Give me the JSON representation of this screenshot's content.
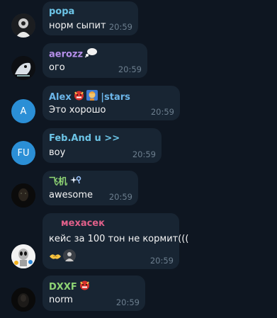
{
  "messages": [
    {
      "name": "popa",
      "name_color": "#6cc4e6",
      "text": "норм сыпит",
      "time": "20:59",
      "avatar": "dark-photo-avatar"
    },
    {
      "name": "aerozz",
      "name_color": "#b48ee8",
      "name_emoji": "thought-balloon-icon",
      "text": "ого",
      "time": "20:59",
      "avatar": "cat-photo-avatar"
    },
    {
      "name": "Alex",
      "name_color": "#6cb6ea",
      "name_suffix": "|stars",
      "name_emojis": [
        "ogre-mask-icon",
        "teacher-icon"
      ],
      "text": "Это хорошо",
      "time": "20:59",
      "avatar": "A",
      "avatar_color": "#2b8fd6"
    },
    {
      "name": "Feb.And u >>",
      "name_color": "#6cc4e6",
      "text": "воу",
      "time": "20:59",
      "avatar": "FU",
      "avatar_color": "#2b8fd6"
    },
    {
      "name": "飞机",
      "name_color": "#8ed474",
      "name_emoji": "sparkle-icon",
      "text": "awesome",
      "time": "20:59",
      "avatar": "dark-photo-avatar"
    },
    {
      "name": "мехасек",
      "name_color": "#e0608a",
      "text": "кейс за 100 тон не кормит(((",
      "time": "20:59",
      "avatar": "alien-sticker-avatar",
      "reactions": [
        "handshake-icon",
        "user-reaction-avatar"
      ]
    },
    {
      "name": "DXXF",
      "name_color": "#8ed474",
      "name_emoji": "ogre-mask-icon",
      "text": "norm",
      "time": "20:59",
      "avatar": "dark-photo-avatar"
    }
  ]
}
